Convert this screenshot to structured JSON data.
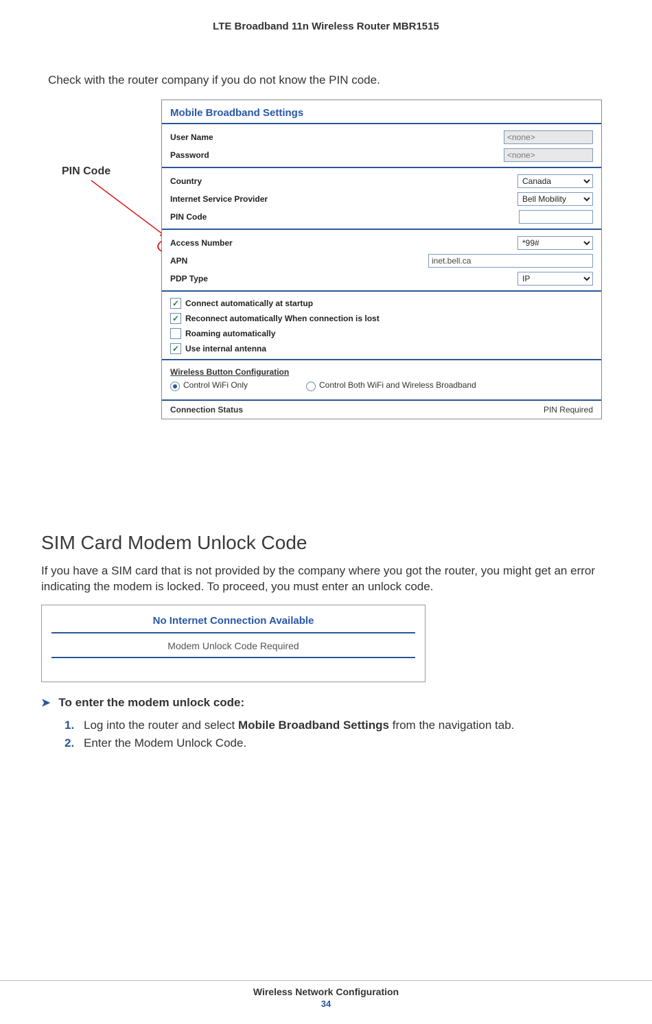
{
  "header": {
    "title": "LTE Broadband 11n Wireless Router MBR1515"
  },
  "intro": "Check with the router company if you do not know the PIN code.",
  "callout": {
    "label": "PIN Code"
  },
  "panel": {
    "title": "Mobile Broadband Settings",
    "userName": {
      "label": "User Name",
      "value": "<none>"
    },
    "password": {
      "label": "Password",
      "value": "<none>"
    },
    "country": {
      "label": "Country",
      "value": "Canada"
    },
    "isp": {
      "label": "Internet Service Provider",
      "value": "Bell Mobility"
    },
    "pin": {
      "label": "PIN Code",
      "value": ""
    },
    "access": {
      "label": "Access Number",
      "value": "*99#"
    },
    "apn": {
      "label": "APN",
      "value": "inet.bell.ca"
    },
    "pdp": {
      "label": "PDP Type",
      "value": "IP"
    },
    "checks": {
      "startup": "Connect automatically at startup",
      "reconnect": "Reconnect automatically When connection is lost",
      "roaming": "Roaming automatically",
      "antenna": "Use internal antenna"
    },
    "wbc": {
      "title": "Wireless Button Configuration",
      "opt1": "Control WiFi Only",
      "opt2": "Control Both WiFi and Wireless Broadband"
    },
    "conn": {
      "label": "Connection Status",
      "value": "PIN Required"
    }
  },
  "section2": {
    "heading": "SIM Card Modem Unlock Code",
    "para": "If you have a SIM card that is not provided by the company where you got the router, you might get an error indicating the modem is locked. To proceed, you must enter an unlock code."
  },
  "nica": {
    "title": "No Internet Connection Available",
    "msg": "Modem Unlock Code Required"
  },
  "procedure": {
    "title": "To enter the modem unlock code:",
    "step1_a": "Log into the router and select ",
    "step1_b": "Mobile Broadband Settings",
    "step1_c": " from the navigation tab.",
    "step2": "Enter the Modem Unlock Code."
  },
  "footer": {
    "section": "Wireless Network Configuration",
    "page": "34"
  }
}
